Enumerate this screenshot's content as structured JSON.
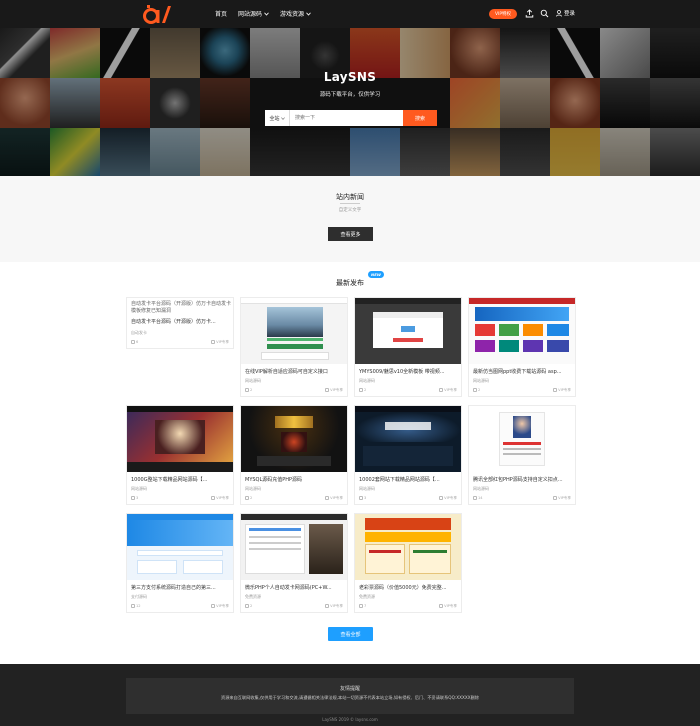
{
  "header": {
    "nav": [
      {
        "label": "首页"
      },
      {
        "label": "网站源码"
      },
      {
        "label": "游戏资源"
      }
    ],
    "vip_label": "VIP特权",
    "login_label": "登录"
  },
  "hero": {
    "title": "LaySNS",
    "subtitle": "源码下载平台，仅供学习",
    "search_scope": "全站",
    "search_placeholder": "搜索一下",
    "search_button": "搜索"
  },
  "news": {
    "title": "站内新闻",
    "subtitle": "自定义文字",
    "more_button": "查看更多"
  },
  "latest": {
    "title": "最新发布",
    "badge": "NEW",
    "more_button": "查看全部",
    "cards": [
      {
        "alt": "自动发卡平台源码（开源版）仿万卡自动发卡模板修复已知漏洞",
        "title": "自动发卡平台源码（开源版）仿万卡...",
        "category": "自动发卡",
        "views": "6",
        "action": "VIP专享"
      },
      {
        "title": "在线VIP解析自适应源码可自定义接口",
        "category": "网站源码",
        "views": "2",
        "action": "VIP专享"
      },
      {
        "title": "YMYS009/魅思v10全新模板 带视频...",
        "category": "网站源码",
        "views": "2",
        "action": "VIP专享"
      },
      {
        "title": "最新仿当图网ppt收费下载站源码 asp...",
        "category": "网站源码",
        "views": "2",
        "action": "VIP专享"
      },
      {
        "title": "1000G整站下载精品网站源码【...",
        "category": "网站源码",
        "views": "3",
        "action": "VIP专享"
      },
      {
        "title": "MYSQL源码充值PHP源码",
        "category": "网站源码",
        "views": "2",
        "action": "VIP专享"
      },
      {
        "title": "10002套网站下载精品网站源码【...",
        "category": "网站源码",
        "views": "3",
        "action": "VIP专享"
      },
      {
        "title": "腾讯全部红包PHP源码支持自定义扣点...",
        "category": "网站源码",
        "views": "14",
        "action": "VIP专享"
      },
      {
        "title": "第三方支付系统源码打造自己的第三...",
        "category": "支付源码",
        "views": "12",
        "action": "VIP专享"
      },
      {
        "title": "微乐PHP个人自动发卡网源码(PC+W...",
        "category": "免费资源",
        "views": "2",
        "action": "VIP专享"
      },
      {
        "title": "老彩票源码（价值5000元）免费完整...",
        "category": "免费资源",
        "views": "7",
        "action": "VIP专享"
      }
    ]
  },
  "footer": {
    "notice_title": "友情提醒",
    "notice_text": "资源来自互联网收集,仅供用于学习和交流,请遵循相关法律法规,本站一切资源不代表本站立场,如有侵权、后门、不妥请联系QQ:XXXXX删除",
    "copyright": "LaySNS 2019 © laysns.com"
  },
  "colors": {
    "accent": "#ff5a1f",
    "blue": "#1e9fff",
    "header_bg": "#121212",
    "footer_bg": "#222222"
  }
}
